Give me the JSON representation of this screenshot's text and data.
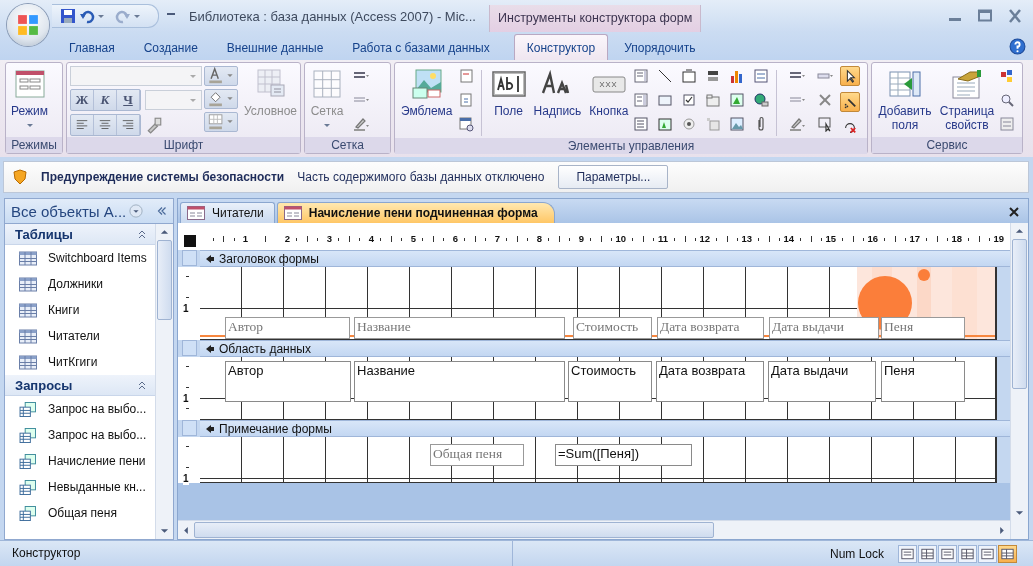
{
  "window": {
    "title": "Библиотека : база данных (Access 2007) - Mic...",
    "context_title": "Инструменты конструктора форм"
  },
  "ribbon_tabs": [
    {
      "label": "Главная",
      "selected": false,
      "kind": "main"
    },
    {
      "label": "Создание",
      "selected": false,
      "kind": "main"
    },
    {
      "label": "Внешние данные",
      "selected": false,
      "kind": "main"
    },
    {
      "label": "Работа с базами данных",
      "selected": false,
      "kind": "main"
    },
    {
      "label": "Конструктор",
      "selected": true,
      "kind": "context"
    },
    {
      "label": "Упорядочить",
      "selected": false,
      "kind": "context"
    }
  ],
  "ribbon": {
    "views": {
      "label": "Режимы",
      "button": "Режим"
    },
    "font": {
      "label": "Шрифт",
      "bold": "Ж",
      "italic": "К",
      "underline": "Ч",
      "conditional": {
        "label": "Условное",
        "disabled": true
      }
    },
    "grid": {
      "label": "Сетка",
      "button": {
        "label": "Сетка",
        "disabled": true
      }
    },
    "controls": {
      "label": "Элементы управления",
      "buttons": [
        "Эмблема",
        "Поле",
        "Надпись",
        "Кнопка"
      ],
      "select_on": true,
      "wizards_on": true
    },
    "tools": {
      "label": "Сервис",
      "buttons": [
        "Добавить поля",
        "Страница свойств"
      ]
    }
  },
  "security": {
    "title": "Предупреждение системы безопасности",
    "message": "Часть содержимого базы данных отключено",
    "button": "Параметры..."
  },
  "nav": {
    "title": "Все объекты A...",
    "groups": [
      {
        "label": "Таблицы",
        "kind": "tables",
        "items": [
          "Switchboard Items",
          "Должники",
          "Книги",
          "Читатели",
          "ЧитКгиги"
        ]
      },
      {
        "label": "Запросы",
        "kind": "queries",
        "items": [
          "Запрос на выбо...",
          "Запрос на выбо...",
          "Начисление пени",
          "Невыданные кн...",
          "Общая пеня"
        ]
      }
    ]
  },
  "doc_tabs": [
    {
      "label": "Читатели",
      "selected": false
    },
    {
      "label": "Начисление пени подчиненная форма",
      "selected": true
    }
  ],
  "ruler": [
    "1",
    "2",
    "3",
    "4",
    "5",
    "6",
    "7",
    "8",
    "9",
    "10",
    "11",
    "12",
    "13",
    "14",
    "15",
    "16",
    "17",
    "18",
    "19"
  ],
  "sections": [
    {
      "kind": "header",
      "title": "Заголовок формы",
      "ruler_label": "1",
      "controls": [
        {
          "kind": "label",
          "text": "Автор"
        },
        {
          "kind": "label",
          "text": "Название"
        },
        {
          "kind": "label",
          "text": "Стоимость"
        },
        {
          "kind": "label",
          "text": "Дата возврата"
        },
        {
          "kind": "label",
          "text": "Дата выдачи"
        },
        {
          "kind": "label",
          "text": "Пеня"
        }
      ]
    },
    {
      "kind": "detail",
      "title": "Область данных",
      "ruler_label": "1",
      "controls": [
        {
          "kind": "textbox",
          "text": "Автор"
        },
        {
          "kind": "textbox",
          "text": "Название"
        },
        {
          "kind": "textbox",
          "text": "Стоимость"
        },
        {
          "kind": "textbox",
          "text": "Дата возврата"
        },
        {
          "kind": "textbox",
          "text": "Дата выдачи"
        },
        {
          "kind": "textbox",
          "text": "Пеня"
        }
      ]
    },
    {
      "kind": "footer",
      "title": "Примечание формы",
      "ruler_label": "1",
      "controls": [
        {
          "kind": "label",
          "text": "Общая пеня"
        },
        {
          "kind": "textbox",
          "text": "=Sum([Пеня])"
        }
      ]
    }
  ],
  "status": {
    "mode": "Конструктор",
    "num_lock": "Num Lock",
    "views": [
      {
        "selected": false
      },
      {
        "selected": false
      },
      {
        "selected": false
      },
      {
        "selected": false
      },
      {
        "selected": false
      },
      {
        "selected": true
      }
    ]
  }
}
